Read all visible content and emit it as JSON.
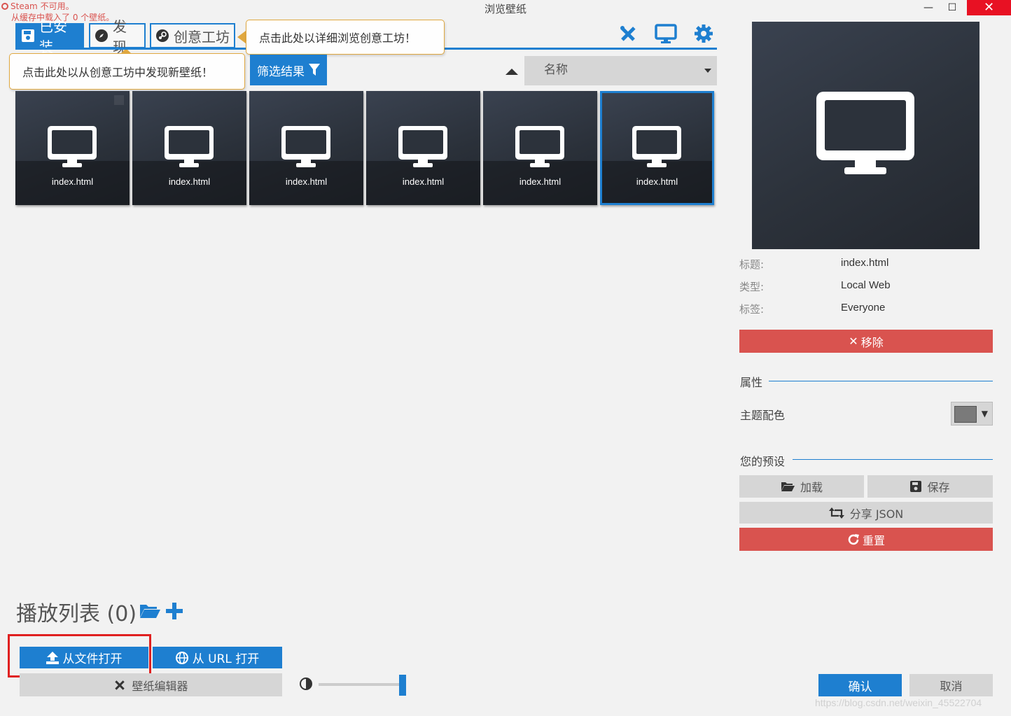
{
  "window": {
    "title": "浏览壁纸",
    "status_steam": "Steam 不可用。",
    "status_cache": "从缓存中载入了 0 个壁纸。",
    "minimize": "—",
    "maximize": "☐",
    "close": "✕"
  },
  "tabs": [
    {
      "label": "已安装",
      "icon": "save-icon",
      "active": true
    },
    {
      "label": "发现",
      "icon": "compass-icon",
      "active": false
    },
    {
      "label": "创意工坊",
      "icon": "steam-icon",
      "active": false
    }
  ],
  "tooltips": {
    "workshop": "点击此处以详细浏览创意工坊！",
    "discover": "点击此处以从创意工坊中发现新壁纸！"
  },
  "toolbar": {
    "filter_label": "筛选结果",
    "sort_value": "名称",
    "icons": [
      "editor-tools-icon",
      "monitor-icon",
      "gear-icon"
    ]
  },
  "wallpapers": [
    {
      "name": "index.html",
      "selected": false
    },
    {
      "name": "index.html",
      "selected": false
    },
    {
      "name": "index.html",
      "selected": false
    },
    {
      "name": "index.html",
      "selected": false
    },
    {
      "name": "index.html",
      "selected": false
    },
    {
      "name": "index.html",
      "selected": true
    }
  ],
  "details": {
    "title_label": "标题:",
    "title_value": "index.html",
    "type_label": "类型:",
    "type_value": "Local Web",
    "tag_label": "标签:",
    "tag_value": "Everyone",
    "remove_label": "移除"
  },
  "properties": {
    "section_label": "属性",
    "theme_color_label": "主题配色",
    "theme_color": "#7a7a7a"
  },
  "presets": {
    "section_label": "您的预设",
    "load_label": "加载",
    "save_label": "保存",
    "share_label": "分享 JSON",
    "reset_label": "重置"
  },
  "playlist": {
    "title": "播放列表 (0)"
  },
  "bottom": {
    "open_file_label": "从文件打开",
    "open_url_label": "从 URL 打开",
    "editor_label": "壁纸编辑器",
    "confirm_label": "确认",
    "cancel_label": "取消",
    "watermark": "https://blog.csdn.net/weixin_45522704"
  },
  "colors": {
    "accent": "#1e7fd0",
    "danger": "#d9534f",
    "highlight_box": "#e02020"
  }
}
